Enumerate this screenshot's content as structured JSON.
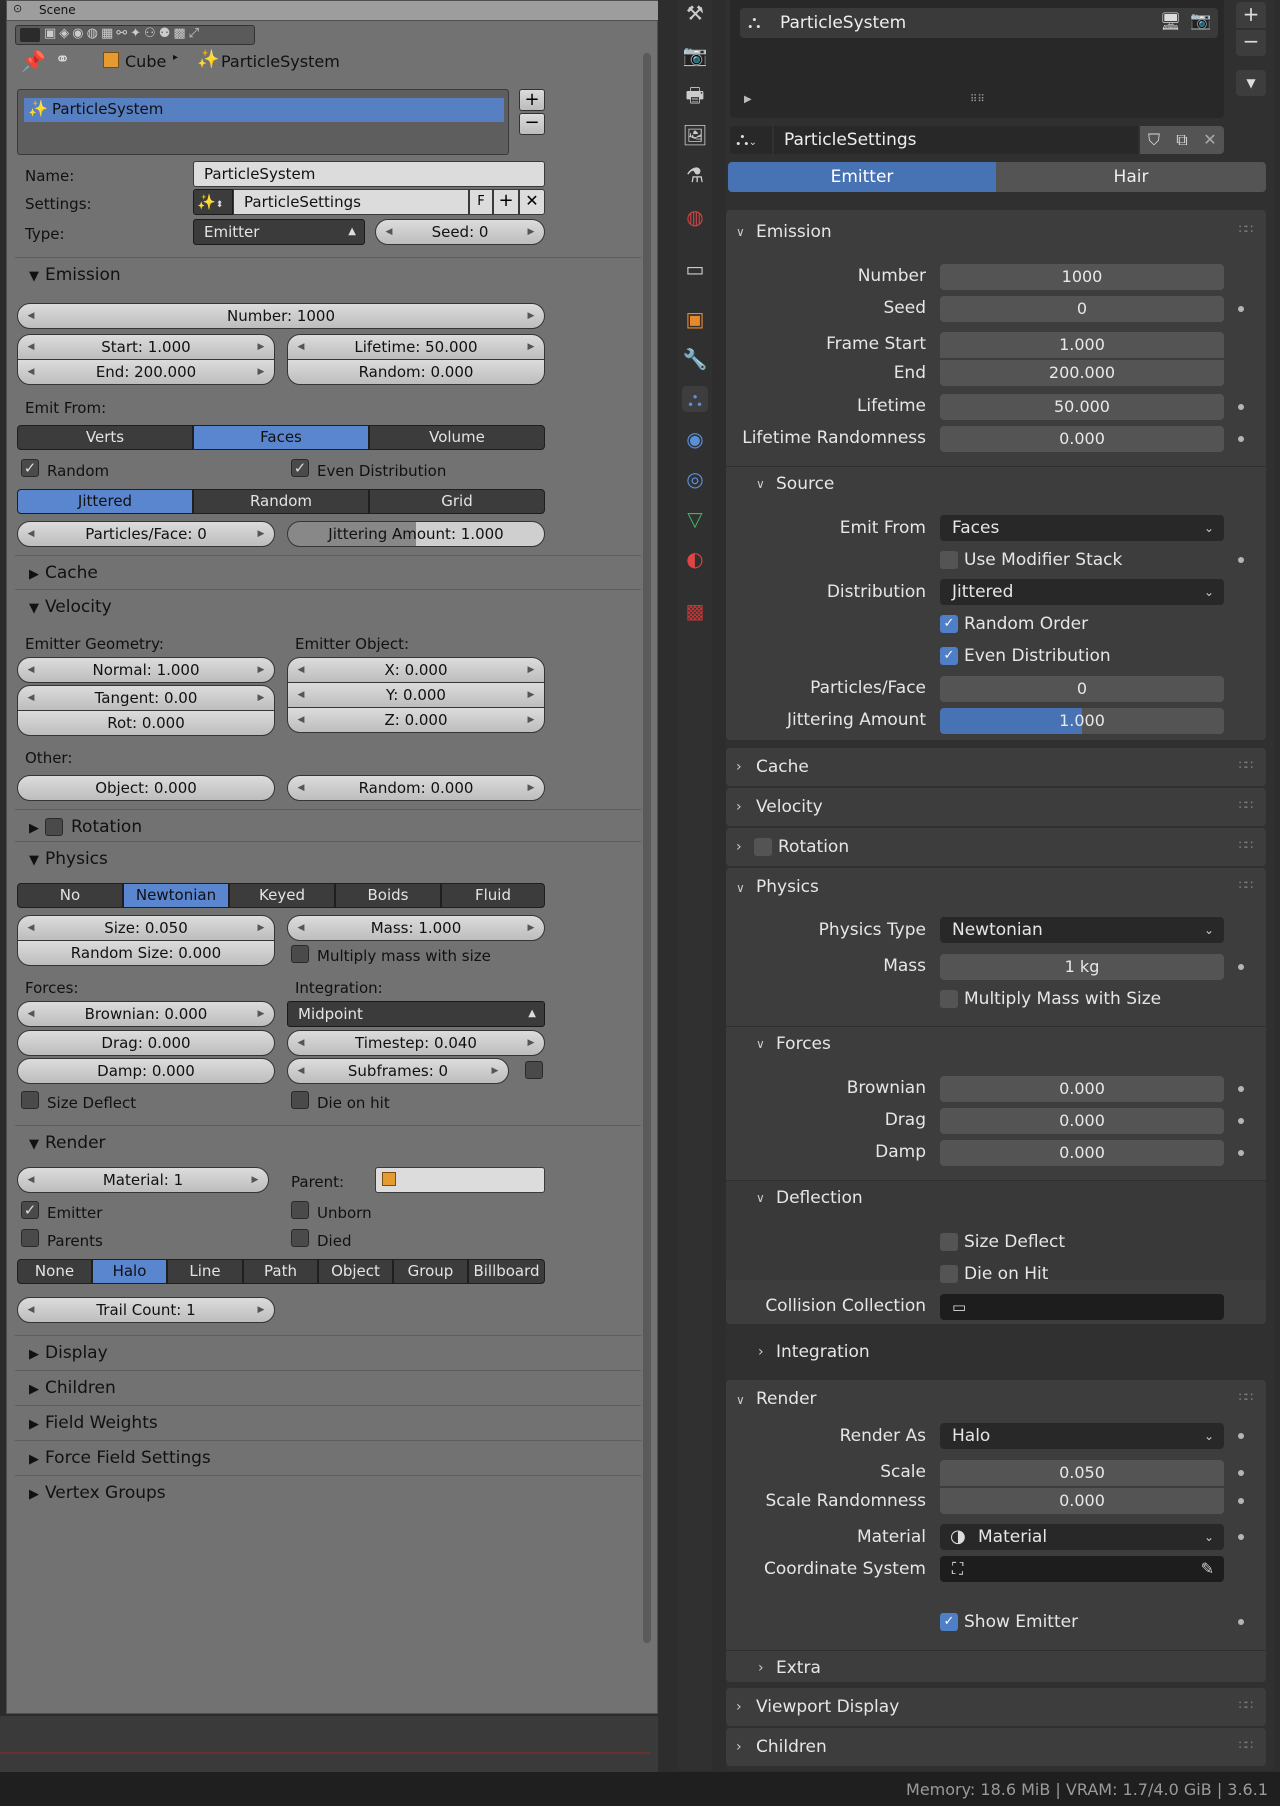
{
  "legacy": {
    "scene_label": "Scene",
    "breadcrumb": {
      "object": "Cube",
      "system": "ParticleSystem"
    },
    "system_list": [
      "ParticleSystem"
    ],
    "name_label": "Name:",
    "name_value": "ParticleSystem",
    "settings_label": "Settings:",
    "settings_value": "ParticleSettings",
    "fake_user": "F",
    "type_label": "Type:",
    "type_value": "Emitter",
    "seed": "Seed: 0",
    "emission": {
      "title": "Emission",
      "number": "Number: 1000",
      "start": "Start: 1.000",
      "end": "End: 200.000",
      "lifetime": "Lifetime: 50.000",
      "random": "Random: 0.000",
      "emit_from_label": "Emit From:",
      "emit_from": [
        "Verts",
        "Faces",
        "Volume"
      ],
      "emit_from_active": 1,
      "random_chk": "Random",
      "even_chk": "Even Distribution",
      "dist": [
        "Jittered",
        "Random",
        "Grid"
      ],
      "dist_active": 0,
      "particles_face": "Particles/Face: 0",
      "jitter": "Jittering Amount: 1.000"
    },
    "cache_title": "Cache",
    "velocity": {
      "title": "Velocity",
      "geom_label": "Emitter Geometry:",
      "obj_label": "Emitter Object:",
      "normal": "Normal: 1.000",
      "tangent": "Tangent: 0.00",
      "rot": "Rot: 0.000",
      "x": "X: 0.000",
      "y": "Y: 0.000",
      "z": "Z: 0.000",
      "other_label": "Other:",
      "object": "Object: 0.000",
      "random": "Random: 0.000"
    },
    "rotation_title": "Rotation",
    "physics": {
      "title": "Physics",
      "types": [
        "No",
        "Newtonian",
        "Keyed",
        "Boids",
        "Fluid"
      ],
      "type_active": 1,
      "size": "Size: 0.050",
      "mass": "Mass: 1.000",
      "random_size": "Random Size: 0.000",
      "multiply": "Multiply mass with size",
      "forces_label": "Forces:",
      "integration_label": "Integration:",
      "brownian": "Brownian: 0.000",
      "drag": "Drag: 0.000",
      "damp": "Damp: 0.000",
      "integration": "Midpoint",
      "timestep": "Timestep: 0.040",
      "subframes": "Subframes: 0",
      "size_deflect": "Size Deflect",
      "die_on_hit": "Die on hit"
    },
    "render": {
      "title": "Render",
      "material": "Material: 1",
      "parent_label": "Parent:",
      "emitter": "Emitter",
      "unborn": "Unborn",
      "parents": "Parents",
      "died": "Died",
      "types": [
        "None",
        "Halo",
        "Line",
        "Path",
        "Object",
        "Group",
        "Billboard"
      ],
      "type_active": 1,
      "trail": "Trail Count: 1"
    },
    "collapsed": [
      "Display",
      "Children",
      "Field Weights",
      "Force Field Settings",
      "Vertex Groups"
    ]
  },
  "modern": {
    "system_name": "ParticleSystem",
    "settings_name": "ParticleSettings",
    "type_tabs": [
      "Emitter",
      "Hair"
    ],
    "type_active": 0,
    "emission": {
      "title": "Emission",
      "rows": [
        {
          "label": "Number",
          "value": "1000"
        },
        {
          "label": "Seed",
          "value": "0"
        },
        {
          "label": "Frame Start",
          "value": "1.000"
        },
        {
          "label": "End",
          "value": "200.000"
        },
        {
          "label": "Lifetime",
          "value": "50.000"
        },
        {
          "label": "Lifetime Randomness",
          "value": "0.000"
        }
      ]
    },
    "source": {
      "title": "Source",
      "emit_from_label": "Emit From",
      "emit_from": "Faces",
      "use_modifier": "Use Modifier Stack",
      "distribution_label": "Distribution",
      "distribution": "Jittered",
      "random_order": "Random Order",
      "even": "Even Distribution",
      "particles_face_label": "Particles/Face",
      "particles_face": "0",
      "jitter_label": "Jittering Amount",
      "jitter": "1.000",
      "jitter_fraction": 0.5
    },
    "cache_title": "Cache",
    "velocity_title": "Velocity",
    "rotation_title": "Rotation",
    "physics": {
      "title": "Physics",
      "type_label": "Physics Type",
      "type": "Newtonian",
      "mass_label": "Mass",
      "mass": "1 kg",
      "multiply": "Multiply Mass with Size"
    },
    "forces": {
      "title": "Forces",
      "rows": [
        {
          "label": "Brownian",
          "value": "0.000"
        },
        {
          "label": "Drag",
          "value": "0.000"
        },
        {
          "label": "Damp",
          "value": "0.000"
        }
      ]
    },
    "deflection": {
      "title": "Deflection",
      "size_deflect": "Size Deflect",
      "die_on_hit": "Die on Hit",
      "collection_label": "Collision Collection"
    },
    "integration_title": "Integration",
    "render": {
      "title": "Render",
      "render_as_label": "Render As",
      "render_as": "Halo",
      "scale_label": "Scale",
      "scale": "0.050",
      "scale_rand_label": "Scale Randomness",
      "scale_rand": "0.000",
      "material_label": "Material",
      "material": "Material",
      "coord_label": "Coordinate System",
      "show_emitter": "Show Emitter"
    },
    "extra_title": "Extra",
    "viewport_display_title": "Viewport Display",
    "children_title": "Children"
  },
  "status": {
    "text": "Memory: 18.6 MiB | VRAM: 1.7/4.0 GiB | 3.6.1"
  }
}
